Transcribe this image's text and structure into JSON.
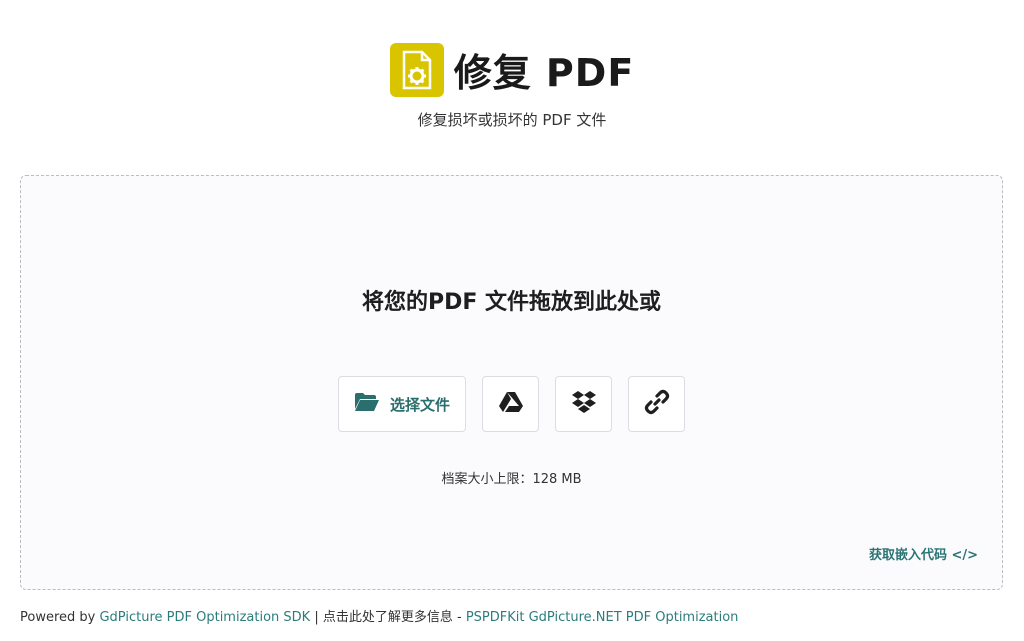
{
  "header": {
    "title": "修复 PDF",
    "subtitle": "修复损坏或损坏的 PDF 文件",
    "logo_icon": "pdf-gear-icon",
    "logo_color": "#d9c400"
  },
  "dropzone": {
    "title": "将您的PDF 文件拖放到此处或",
    "choose_file_label": "选择文件",
    "choose_file_icon": "folder-open-icon",
    "google_drive_icon": "google-drive-icon",
    "dropbox_icon": "dropbox-icon",
    "link_icon": "link-icon",
    "size_limit": "档案大小上限：128 MB",
    "embed_label": "获取嵌入代码 </>",
    "accent_color": "#2b6e6e"
  },
  "footer": {
    "prefix": "Powered by ",
    "sdk_link": "GdPicture PDF Optimization SDK",
    "separator": " | 点击此处了解更多信息 - ",
    "product_link": "PSPDFKit GdPicture.NET PDF Optimization"
  }
}
